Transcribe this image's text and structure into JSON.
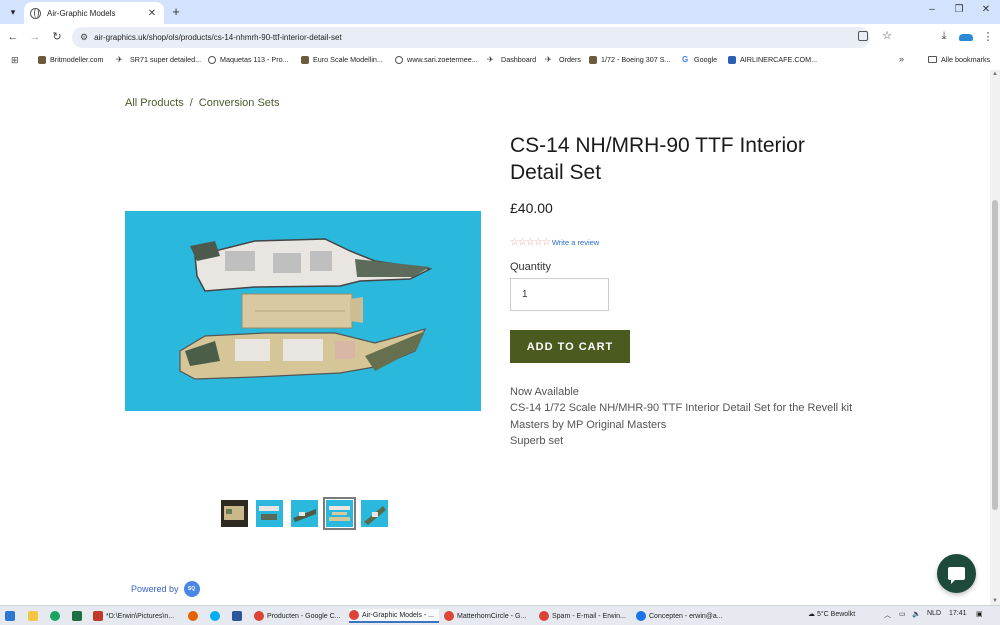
{
  "browser": {
    "tab_title": "Air-Graphic Models",
    "url": "air-graphics.uk/shop/ols/products/cs-14-nhmrh-90-ttf-interior-detail-set",
    "bookmarks": [
      {
        "label": "Britmodeller.com",
        "icon": "box"
      },
      {
        "label": "SR71 super detailed...",
        "icon": "plane"
      },
      {
        "label": "Maquetas 113 - Pro...",
        "icon": "globe"
      },
      {
        "label": "Euro Scale Modellin...",
        "icon": "box"
      },
      {
        "label": "www.sari.zoetermee...",
        "icon": "globe"
      },
      {
        "label": "Dashboard",
        "icon": "plane"
      },
      {
        "label": "Orders",
        "icon": "plane"
      },
      {
        "label": "1/72 - Boeing 307 S...",
        "icon": "box"
      },
      {
        "label": "Google",
        "icon": "g"
      },
      {
        "label": "AIRLINERCAFE.COM...",
        "icon": "a"
      }
    ],
    "bookmarks_folder": "Alle bookmarks"
  },
  "breadcrumb": {
    "all_products": "All Products",
    "separator": "/",
    "category": "Conversion Sets"
  },
  "product": {
    "title": "CS-14 NH/MRH-90 TTF Interior Detail Set",
    "price": "£40.00",
    "rating_stars": "☆☆☆☆☆",
    "review_link": "Write a review",
    "quantity_label": "Quantity",
    "quantity_value": "1",
    "add_to_cart": "ADD TO CART",
    "description": [
      "Now Available",
      "CS-14 1/72 Scale NH/MHR-90 TTF Interior Detail Set for the Revell kit",
      "Masters by MP Original Masters",
      "Superb set"
    ],
    "thumbnails_count": 5,
    "active_thumbnail_index": 3
  },
  "footer": {
    "powered_by": "Powered by",
    "badge_text": "SQ"
  },
  "taskbar": {
    "apps": [
      {
        "label": "*D:\\Erwin\\Pictures\\n...",
        "color": "#c0392b"
      },
      {
        "label": "Producten - Google C...",
        "color": "#db4437"
      },
      {
        "label": "Air-Graphic Models - ...",
        "color": "#db4437"
      },
      {
        "label": "MatterhornCircle - G...",
        "color": "#db4437"
      },
      {
        "label": "Spam - E-mail - Erwin...",
        "color": "#db4437"
      },
      {
        "label": "Concepten - erwin@a...",
        "color": "#1a73e8"
      }
    ],
    "weather": "5°C  Bewolkt",
    "language": "NLD",
    "time": "17:41"
  }
}
